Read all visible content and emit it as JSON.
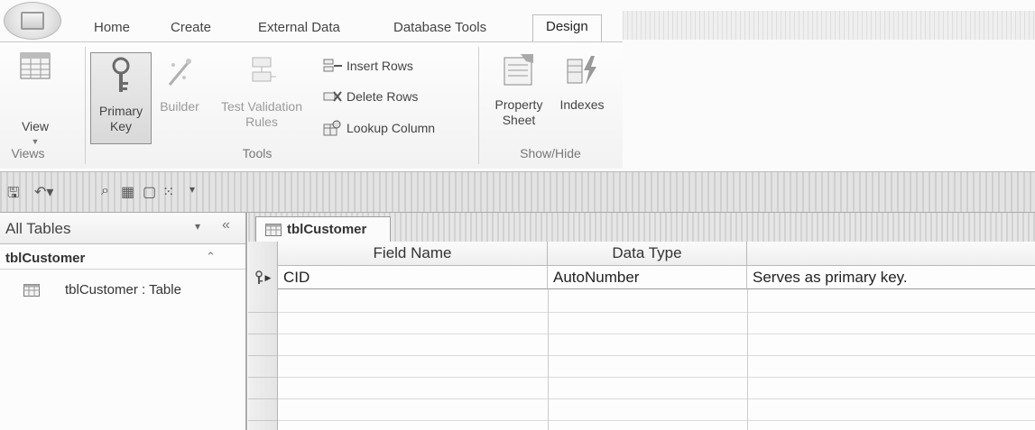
{
  "ribbon_tabs": [
    "Home",
    "Create",
    "External Data",
    "Database Tools",
    "Design"
  ],
  "active_tab": "Design",
  "groups": {
    "views": {
      "label": "Views",
      "view_label": "View"
    },
    "tools": {
      "label": "Tools",
      "primary_key_line1": "Primary",
      "primary_key_line2": "Key",
      "builder": "Builder",
      "test_line1": "Test Validation",
      "test_line2": "Rules",
      "insert_rows": "Insert Rows",
      "delete_rows": "Delete Rows",
      "lookup_column": "Lookup Column"
    },
    "show_hide": {
      "label": "Show/Hide",
      "property_line1": "Property",
      "property_line2": "Sheet",
      "indexes": "Indexes"
    }
  },
  "nav": {
    "header": "All Tables",
    "group": "tblCustomer",
    "item": "tblCustomer : Table"
  },
  "document": {
    "tab_label": "tblCustomer",
    "columns": [
      "Field Name",
      "Data Type",
      ""
    ],
    "rows": [
      {
        "field": "CID",
        "type": "AutoNumber",
        "description": "Serves as primary key."
      }
    ]
  }
}
